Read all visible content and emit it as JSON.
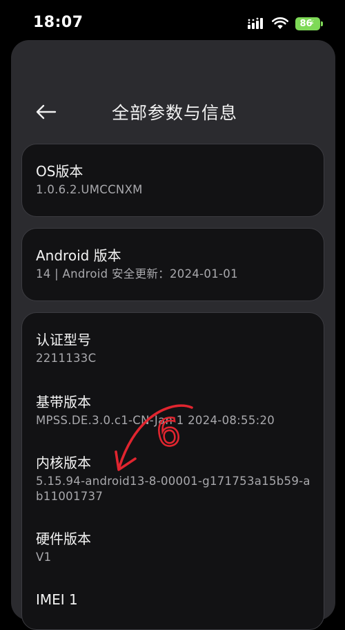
{
  "status_bar": {
    "time": "18:07",
    "battery_level": "86"
  },
  "header": {
    "title": "全部参数与信息",
    "back_icon": "arrow-left-icon"
  },
  "cards": {
    "os": {
      "label": "OS版本",
      "value": "1.0.6.2.UMCCNXM"
    },
    "android": {
      "label": "Android 版本",
      "value": "14 | Android 安全更新：2024-01-01"
    },
    "details": [
      {
        "label": "认证型号",
        "value": "2211133C"
      },
      {
        "label": "基带版本",
        "value": "MPSS.DE.3.0.c1-CN-Jan  1 2024-08:55:20"
      },
      {
        "label": "内核版本",
        "value": "5.15.94-android13-8-00001-g171753a15b59-ab11001737"
      },
      {
        "label": "硬件版本",
        "value": "V1"
      },
      {
        "label": "IMEI 1",
        "value": ""
      }
    ]
  },
  "annotation": {
    "text": "6",
    "color": "#e0252f"
  },
  "colors": {
    "background": "#000000",
    "sheet": "#2b2b2f",
    "card": "#121214",
    "battery": "#7ed957"
  }
}
